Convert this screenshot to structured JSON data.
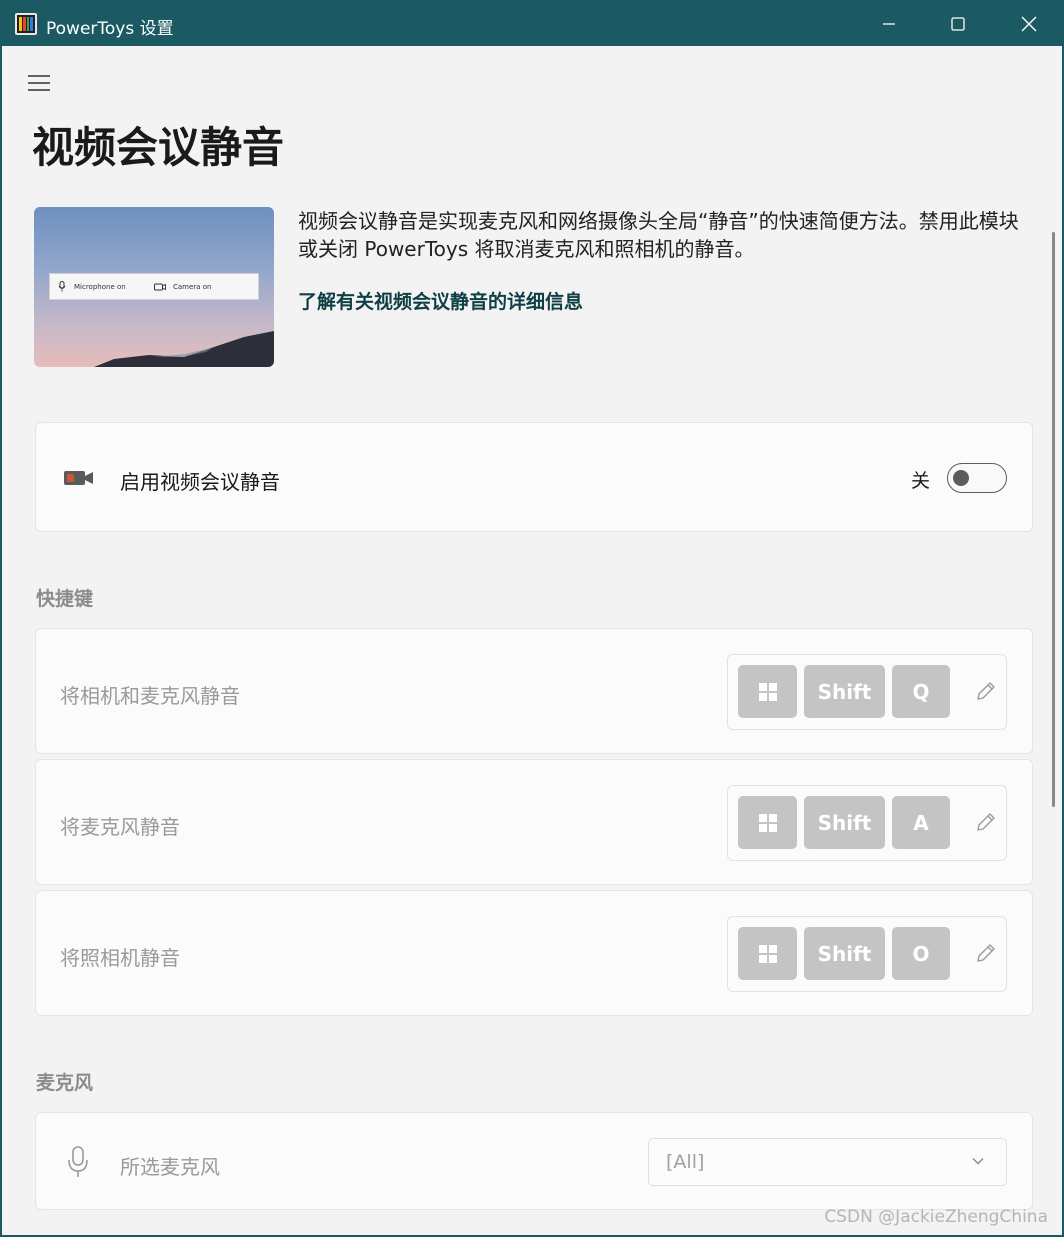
{
  "window": {
    "title": "PowerToys 设置",
    "controls": {
      "minimize": "minimize-icon",
      "maximize": "maximize-icon",
      "close": "close-icon"
    }
  },
  "page": {
    "title": "视频会议静音",
    "description": "视频会议静音是实现麦克风和网络摄像头全局“静音”的快速简便方法。禁用此模块或关闭 PowerToys 将取消麦克风和照相机的静音。",
    "learn_more": "了解有关视频会议静音的详细信息"
  },
  "hero_image": {
    "mic_label": "Microphone on",
    "camera_label": "Camera on"
  },
  "enable_card": {
    "icon": "video-camera-icon",
    "label": "启用视频会议静音",
    "state_label": "关",
    "enabled": false
  },
  "shortcuts": {
    "heading": "快捷键",
    "items": [
      {
        "label": "将相机和麦克风静音",
        "keys": [
          "win-logo",
          "Shift",
          "Q"
        ]
      },
      {
        "label": "将麦克风静音",
        "keys": [
          "win-logo",
          "Shift",
          "A"
        ]
      },
      {
        "label": "将照相机静音",
        "keys": [
          "win-logo",
          "Shift",
          "O"
        ]
      }
    ]
  },
  "microphone": {
    "heading": "麦克风",
    "icon": "microphone-icon",
    "label": "所选麦克风",
    "selected": "[All]"
  },
  "watermark": "CSDN @JackieZhengChina",
  "colors": {
    "titlebar": "#1b5a63",
    "link": "#0f3f45",
    "key_bg": "#c4c4c4",
    "background": "#f3f3f3"
  }
}
